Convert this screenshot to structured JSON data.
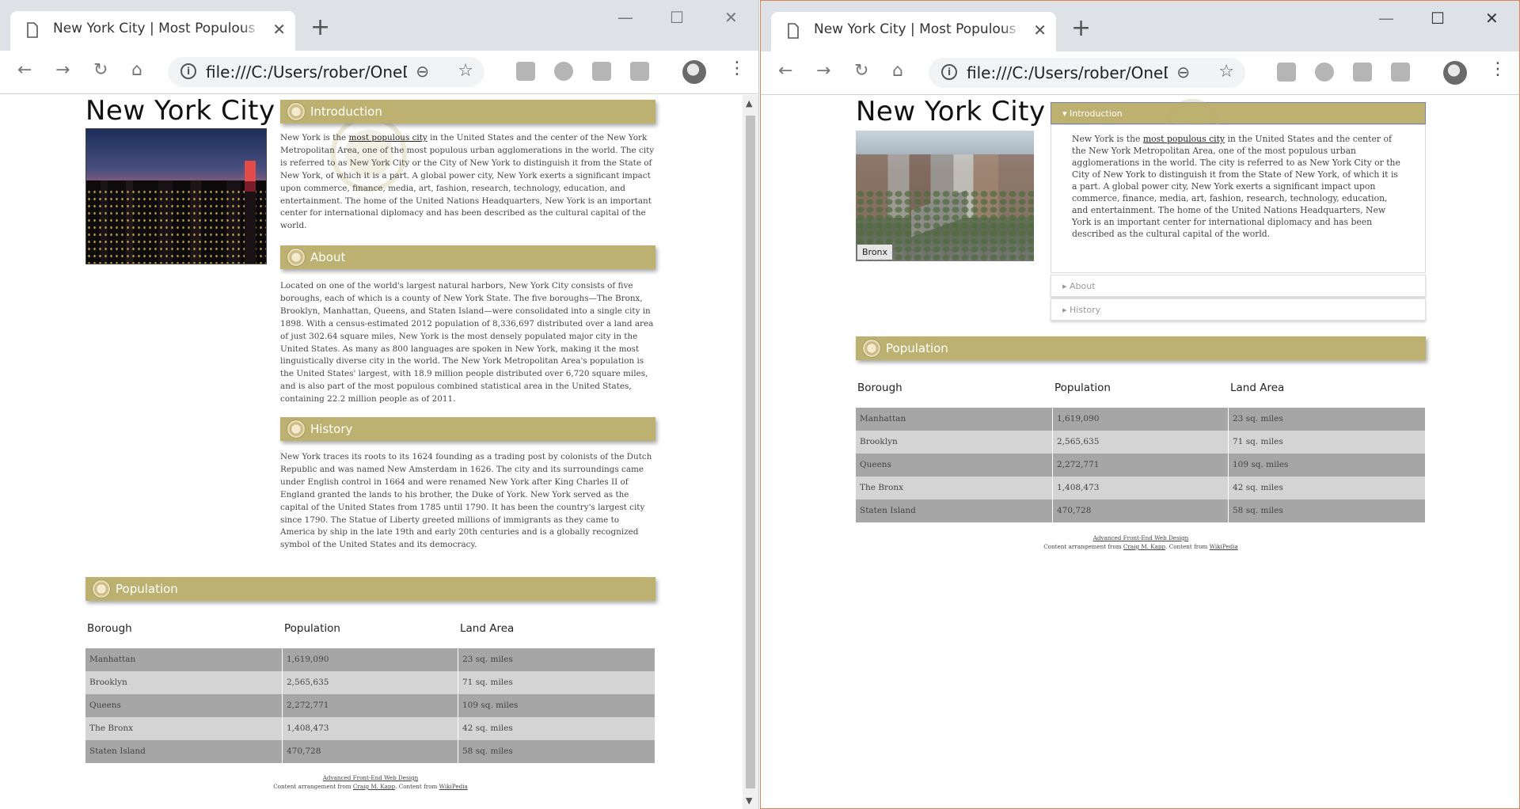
{
  "browser": {
    "tab_title": "New York City | Most Populous City in the United States",
    "tab_close": "✕",
    "new_tab": "+",
    "url": "file:///C:/Users/rober/OneDrive/Documents/nyc/index.html",
    "window_minimize": "—",
    "window_maximize": "☐",
    "window_close": "✕"
  },
  "page": {
    "title": "New York City",
    "hero_caption_right": "Bronx",
    "sections": {
      "intro": {
        "heading": "Introduction",
        "text_before_link": "New York is the ",
        "link": "most populous city",
        "text_after_link": " in the United States and the center of the New York Metropolitan Area, one of the most populous urban agglomerations in the world. The city is referred to as New York City or the City of New York to distinguish it from the State of New York, of which it is a part. A global power city, New York exerts a significant impact upon commerce, finance, media, art, fashion, research, technology, education, and entertainment. The home of the United Nations Headquarters, New York is an important center for international diplomacy and has been described as the cultural capital of the world."
      },
      "about": {
        "heading": "About",
        "text": "Located on one of the world's largest natural harbors, New York City consists of five boroughs, each of which is a county of New York State. The five boroughs—The Bronx, Brooklyn, Manhattan, Queens, and Staten Island—were consolidated into a single city in 1898. With a census-estimated 2012 population of 8,336,697 distributed over a land area of just 302.64 square miles, New York is the most densely populated major city in the United States. As many as 800 languages are spoken in New York, making it the most linguistically diverse city in the world. The New York Metropolitan Area's population is the United States' largest, with 18.9 million people distributed over 6,720 square miles, and is also part of the most populous combined statistical area in the United States, containing 22.2 million people as of 2011."
      },
      "history": {
        "heading": "History",
        "text": "New York traces its roots to its 1624 founding as a trading post by colonists of the Dutch Republic and was named New Amsterdam in 1626. The city and its surroundings came under English control in 1664 and were renamed New York after King Charles II of England granted the lands to his brother, the Duke of York. New York served as the capital of the United States from 1785 until 1790. It has been the country's largest city since 1790. The Statue of Liberty greeted millions of immigrants as they came to America by ship in the late 19th and early 20th centuries and is a globally recognized symbol of the United States and its democracy."
      },
      "population": {
        "heading": "Population"
      }
    },
    "table": {
      "headers": [
        "Borough",
        "Population",
        "Land Area"
      ],
      "rows": [
        [
          "Manhattan",
          "1,619,090",
          "23 sq. miles"
        ],
        [
          "Brooklyn",
          "2,565,635",
          "71 sq. miles"
        ],
        [
          "Queens",
          "2,272,771",
          "109 sq. miles"
        ],
        [
          "The Bronx",
          "1,408,473",
          "42 sq. miles"
        ],
        [
          "Staten Island",
          "470,728",
          "58 sq. miles"
        ]
      ]
    },
    "footer": {
      "line1": "Advanced Front-End Web Design",
      "line2_prefix": "Content arrangement from ",
      "author": "Craig M. Kapp",
      "line2_middle": ". Content from ",
      "source": "WikiPedia"
    },
    "accordion": {
      "intro_label": "▾ Introduction",
      "about_label": "▸ About",
      "history_label": "▸ History"
    }
  },
  "colors": {
    "section_header": "#bcb170",
    "row_dark": "#a6a6a6",
    "row_light": "#d4d4d4"
  }
}
